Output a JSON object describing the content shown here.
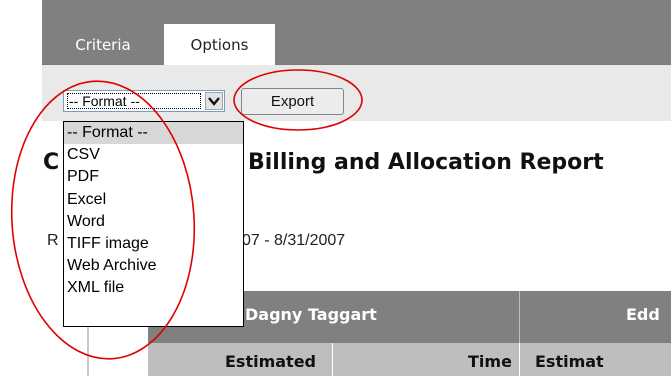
{
  "tabs": [
    {
      "label": "Criteria",
      "active": false
    },
    {
      "label": "Options",
      "active": true
    }
  ],
  "toolbar": {
    "format_select": {
      "selected": "-- Format --",
      "options": [
        "-- Format --",
        "CSV",
        "PDF",
        "Excel",
        "Word",
        "TIFF image",
        "Web Archive",
        "XML file"
      ]
    },
    "export_label": "Export"
  },
  "report": {
    "title_left": "C",
    "title": "Billing and Allocation Report",
    "date_prefix": "R",
    "date_range": "07 - 8/31/2007"
  },
  "table": {
    "people": [
      "Dagny Taggart",
      "Edd"
    ],
    "subheaders": [
      "Estimated",
      "Time",
      "Estimat"
    ]
  },
  "colors": {
    "tab_bar": "#808080",
    "toolbar": "#e9e9e9",
    "annotation": "#e00000",
    "header": "#808080",
    "subheader": "#bebebe"
  }
}
